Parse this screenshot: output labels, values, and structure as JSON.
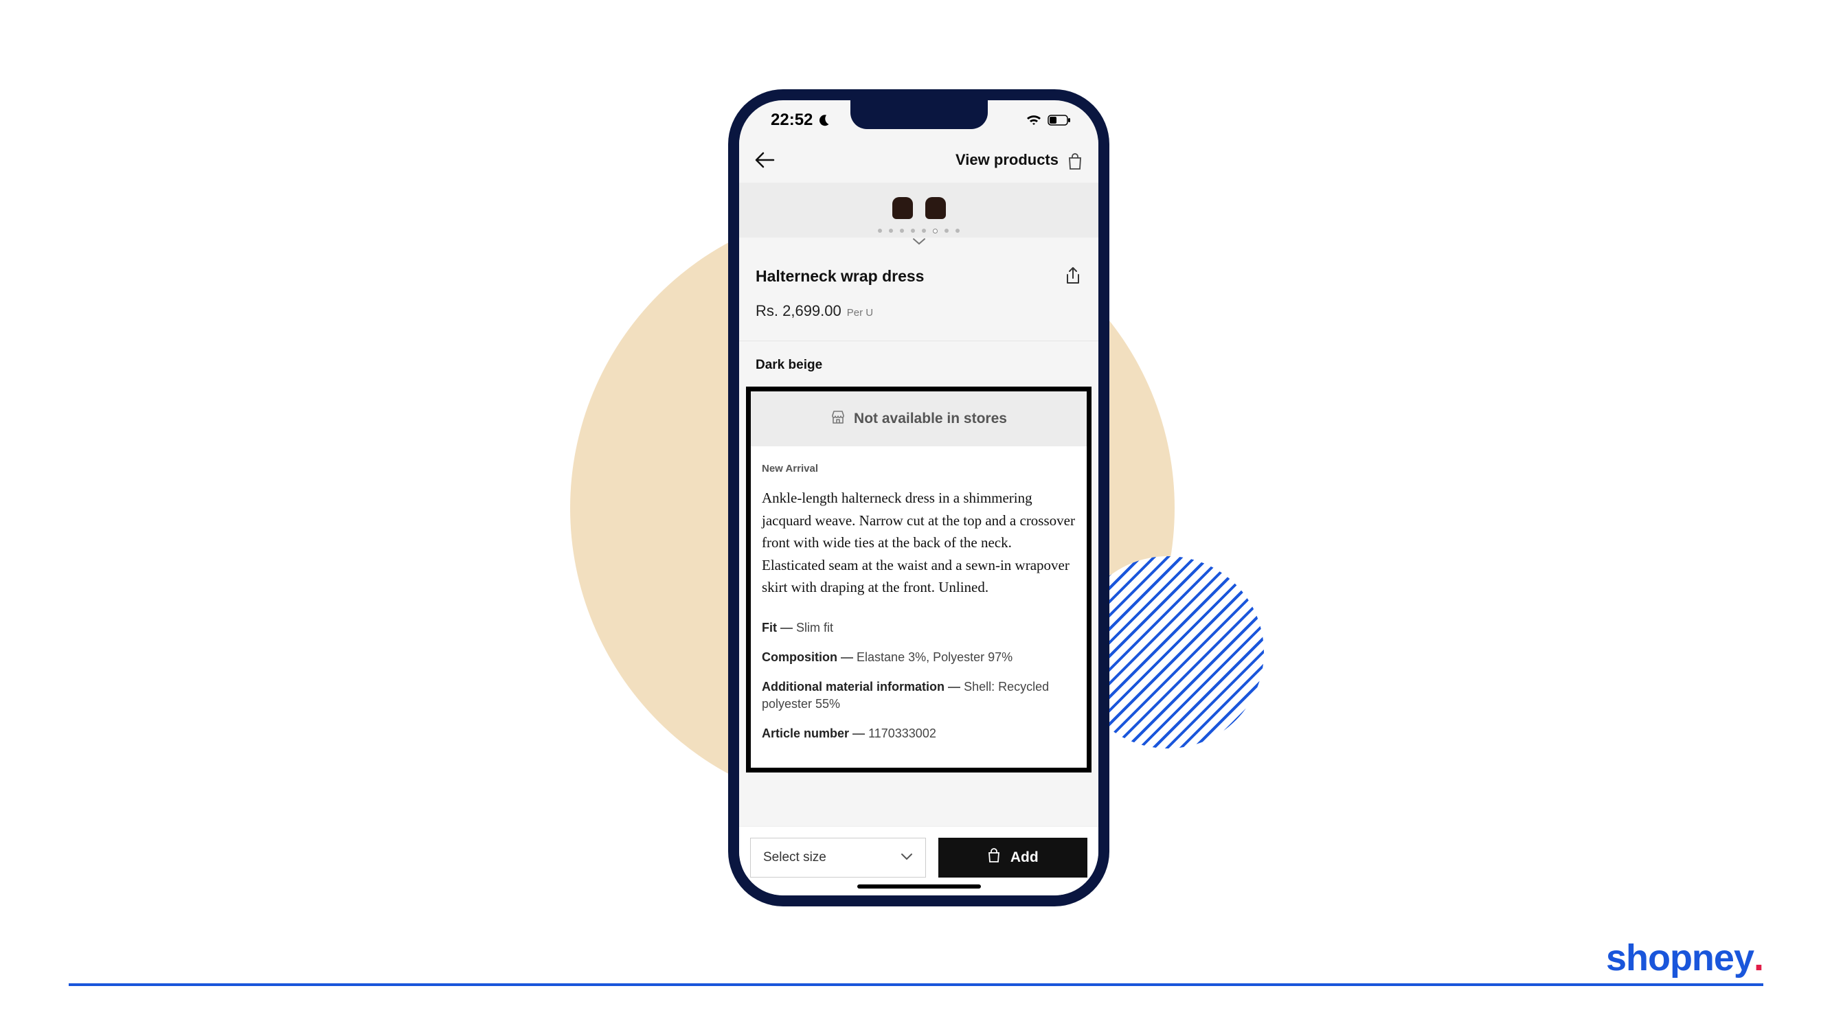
{
  "status": {
    "time": "22:52"
  },
  "header": {
    "view_products": "View products"
  },
  "product": {
    "title": "Halterneck wrap dress",
    "price": "Rs. 2,699.00",
    "price_unit": "Per U",
    "color": "Dark beige",
    "availability": "Not available in stores",
    "badge": "New Arrival",
    "description": "Ankle-length halterneck dress in a shimmering jacquard weave. Narrow cut at the top and a crossover front with wide ties at the back of the neck. Elasticated seam at the waist and a sewn-in wrapover skirt with draping at the front. Unlined.",
    "specs": {
      "fit_label": "Fit",
      "fit_value": "Slim fit",
      "composition_label": "Composition",
      "composition_value": "Elastane 3%, Polyester 97%",
      "material_label": "Additional material information",
      "material_value": "Shell: Recycled polyester 55%",
      "article_label": "Article number",
      "article_value": "1170333002"
    }
  },
  "actions": {
    "select_size": "Select size",
    "add": "Add"
  },
  "brand": {
    "name": "shopney",
    "dot": "."
  }
}
